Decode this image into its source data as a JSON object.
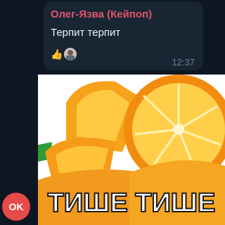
{
  "message": {
    "sender": "Олег-Язва (Кейпоп)",
    "sender_color": "#e0566a",
    "text": "Терпит терпит",
    "time": "12:37",
    "reactions": [
      {
        "type": "emoji",
        "icon": "thumbs-up-icon",
        "glyph": "👍"
      },
      {
        "type": "avatar",
        "icon": "reactor-avatar"
      }
    ]
  },
  "image_message": {
    "caption": "ТИШЕ ТИШЕ",
    "icon": "oranges-image"
  },
  "avatar": {
    "initials": "OK",
    "color": "#e64a4a"
  }
}
